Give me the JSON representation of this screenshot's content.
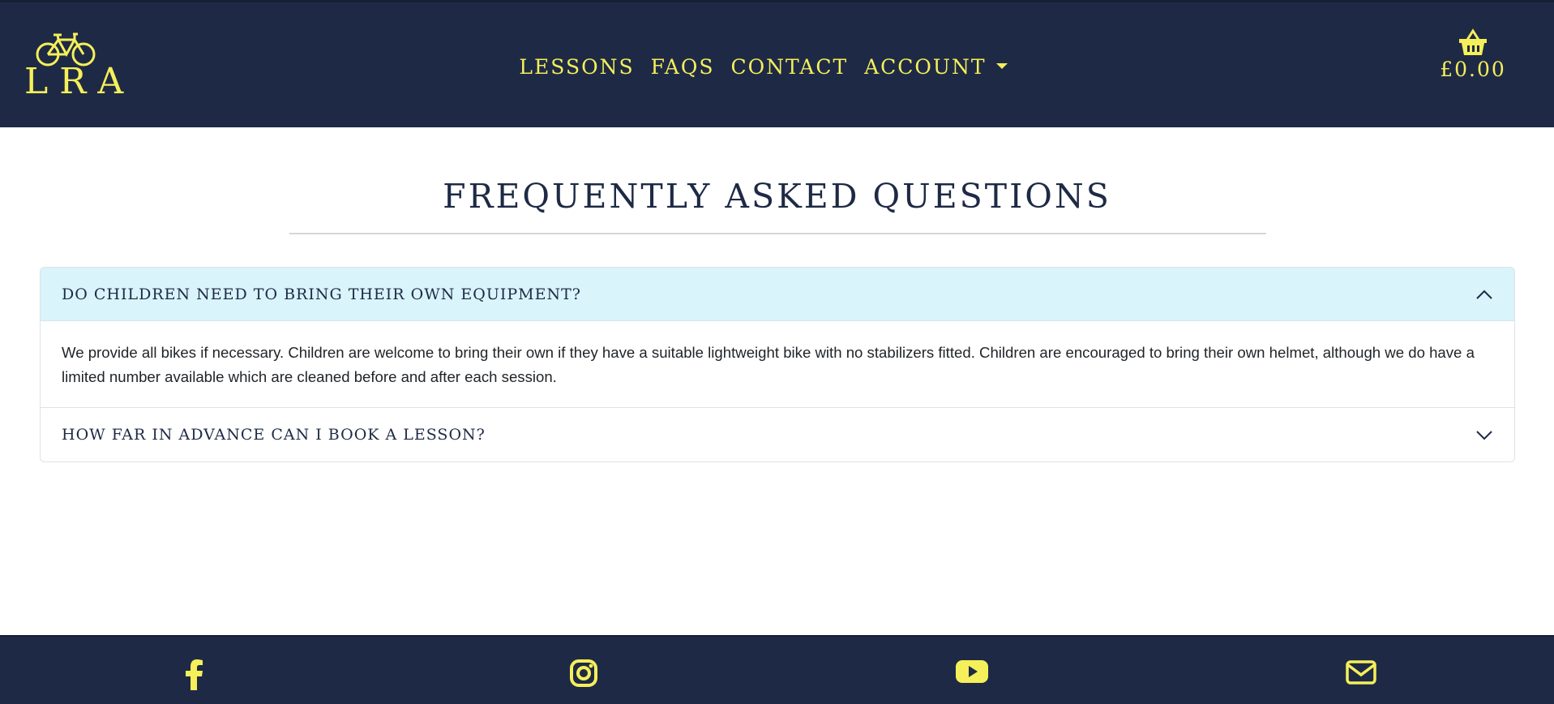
{
  "brand": {
    "logo_text": "LRA",
    "accent_color": "#f5ef5a",
    "nav_color": "#1e2a45"
  },
  "nav": {
    "items": [
      {
        "label": "LESSONS"
      },
      {
        "label": "FAQS"
      },
      {
        "label": "CONTACT"
      },
      {
        "label": "ACCOUNT"
      }
    ]
  },
  "basket": {
    "icon": "basket-icon",
    "total": "£0.00"
  },
  "page": {
    "title": "FREQUENTLY ASKED QUESTIONS"
  },
  "faqs": [
    {
      "question": "DO CHILDREN NEED TO BRING THEIR OWN EQUIPMENT?",
      "answer": "We provide all bikes if necessary. Children are welcome to bring their own if they have a suitable lightweight bike with no stabilizers fitted. Children are encouraged to bring their own helmet, although we do have a limited number available which are cleaned before and after each session.",
      "expanded": true
    },
    {
      "question": "HOW FAR IN ADVANCE CAN I BOOK A LESSON?",
      "expanded": false
    }
  ],
  "footer": {
    "icons": [
      "facebook-icon",
      "instagram-icon",
      "youtube-icon",
      "envelope-icon"
    ]
  }
}
